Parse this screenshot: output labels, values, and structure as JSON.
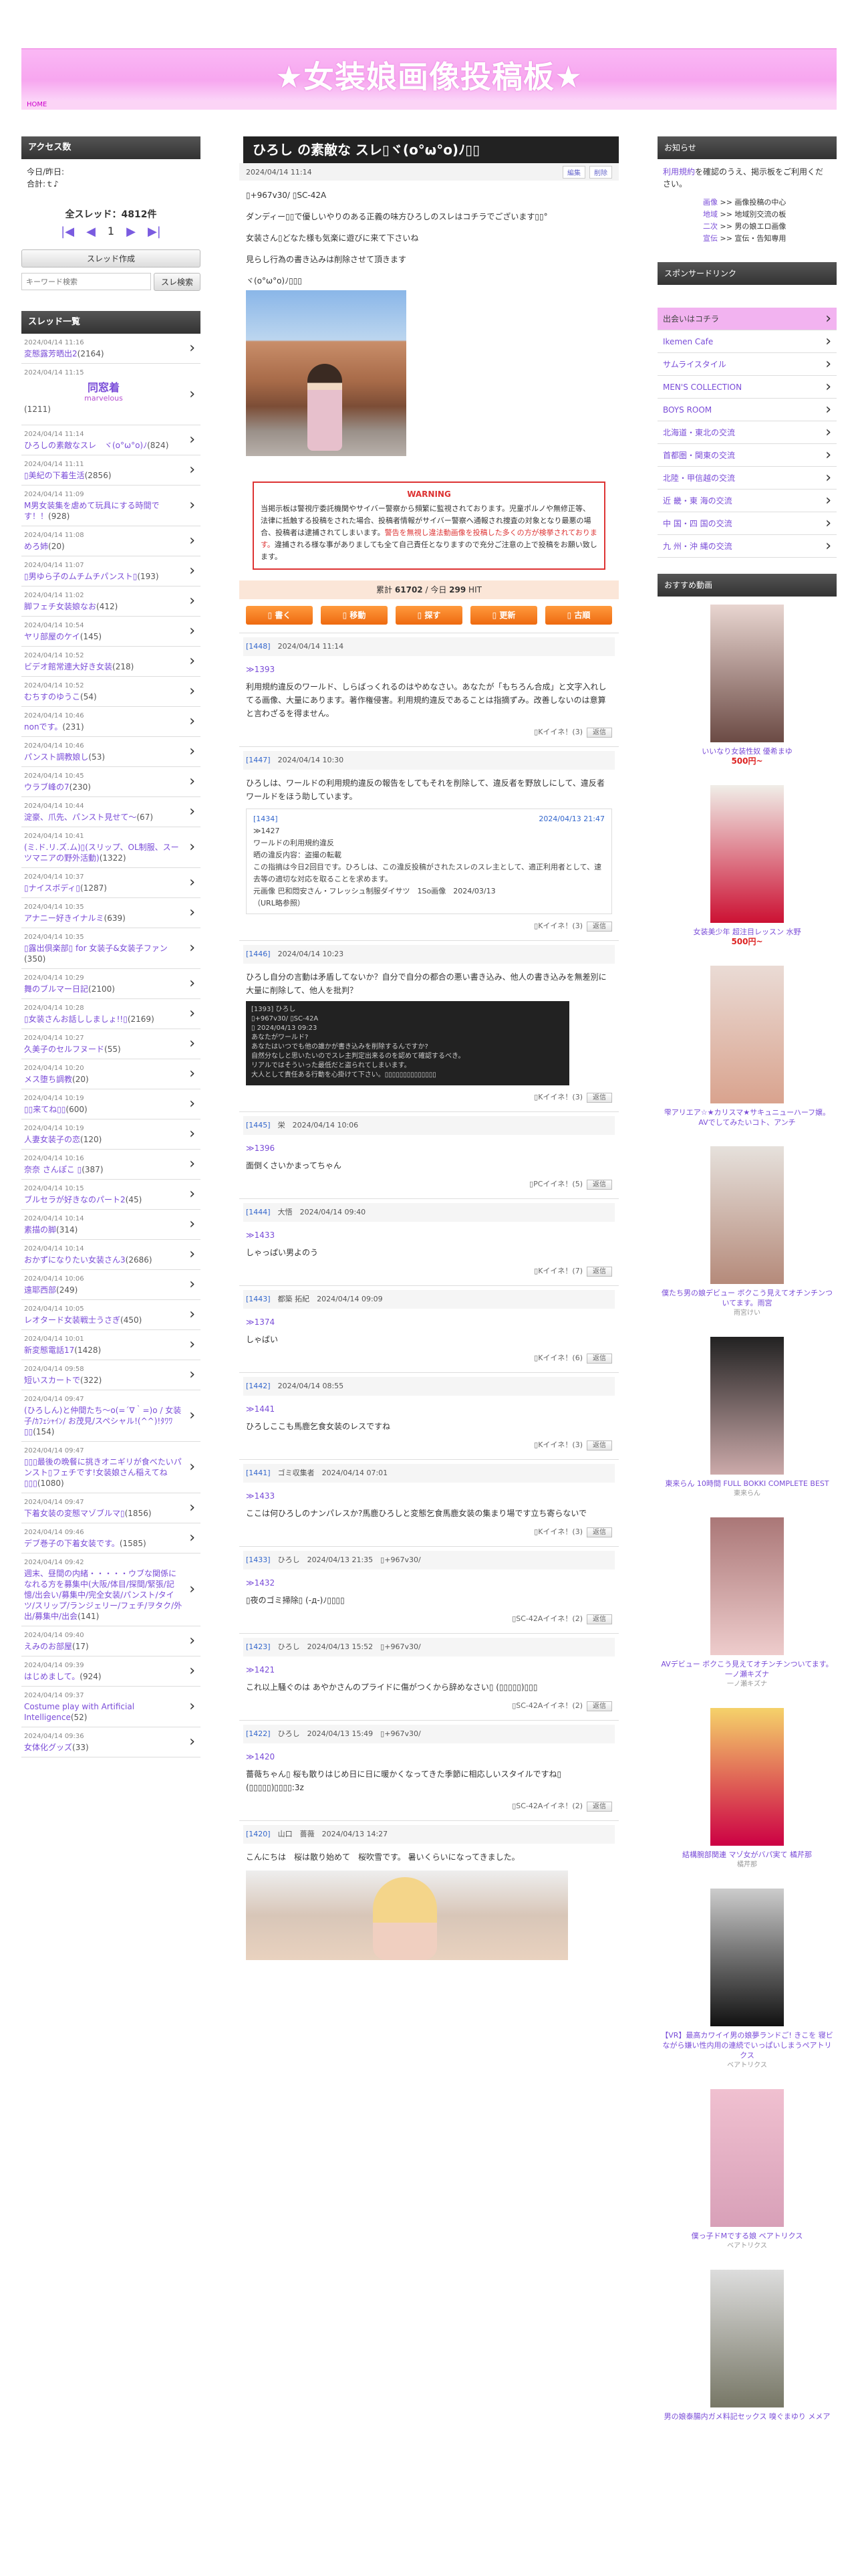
{
  "site": {
    "title": "★女装娘画像投稿板★",
    "crumb": "HOME"
  },
  "left": {
    "access_title": "アクセス数",
    "today": "今日/昨日:",
    "total": "合計:ｔ♪",
    "thread_count": "全スレッド：4812件",
    "page": "1",
    "create_btn": "スレッド作成",
    "search_placeholder": "キーワード検索",
    "search_btn": "スレ検索",
    "list_title": "スレッド一覧",
    "threads": [
      {
        "d": "2024/04/14 11:16",
        "t": "変態露芳晒出2",
        "c": "(2164)"
      },
      {
        "d": "2024/04/14 11:15",
        "t": "同窓着",
        "s": "marvelous",
        "c": "(1211)",
        "big": true
      },
      {
        "d": "2024/04/14 11:14",
        "t": "ひろしの素敵なスレ　ヾ(o°ω°o)ﾉ",
        "c": "(824)"
      },
      {
        "d": "2024/04/14 11:11",
        "t": "▯美紀の下着生活",
        "c": "(2856)"
      },
      {
        "d": "2024/04/14 11:09",
        "t": "M男女装集を虐めて玩具にする時間です！！",
        "c": "(928)"
      },
      {
        "d": "2024/04/14 11:08",
        "t": "めろ姉",
        "c": "(20)"
      },
      {
        "d": "2024/04/14 11:07",
        "t": "▯男ゆら子のムチムチパンスト▯",
        "c": "(193)"
      },
      {
        "d": "2024/04/14 11:02",
        "t": "脚フェチ女装娘なお",
        "c": "(412)"
      },
      {
        "d": "2024/04/14 10:54",
        "t": "ヤリ部屋のケイ",
        "c": "(145)"
      },
      {
        "d": "2024/04/14 10:52",
        "t": "ビデオ館常連大好き女装",
        "c": "(218)"
      },
      {
        "d": "2024/04/14 10:52",
        "t": "むちすのゆうこ",
        "c": "(54)"
      },
      {
        "d": "2024/04/14 10:46",
        "t": "nonです。",
        "c": "(231)"
      },
      {
        "d": "2024/04/14 10:46",
        "t": "パンスト調教娘し",
        "c": "(53)"
      },
      {
        "d": "2024/04/14 10:45",
        "t": "ウラブ峰の7",
        "c": "(230)"
      },
      {
        "d": "2024/04/14 10:44",
        "t": "淀豪、爪先、パンスト見せて〜",
        "c": "(67)"
      },
      {
        "d": "2024/04/14 10:41",
        "t": "(ミ.ド.リ.ズ.ム)▯(スリップ、OL制服、スーツマニアの野外活動)",
        "c": "(1322)"
      },
      {
        "d": "2024/04/14 10:37",
        "t": "▯ナイスボディ▯",
        "c": "(1287)"
      },
      {
        "d": "2024/04/14 10:35",
        "t": "アナニー好きイナルミ",
        "c": "(639)"
      },
      {
        "d": "2024/04/14 10:35",
        "t": "▯露出倶楽部▯ for 女装子&女装子ファン",
        "c": "(350)"
      },
      {
        "d": "2024/04/14 10:29",
        "t": "舞のブルマー日記",
        "c": "(2100)"
      },
      {
        "d": "2024/04/14 10:28",
        "t": "▯女装さんお話ししましょ!!▯",
        "c": "(2169)"
      },
      {
        "d": "2024/04/14 10:27",
        "t": "久美子のセルフヌード",
        "c": "(55)"
      },
      {
        "d": "2024/04/14 10:20",
        "t": "メス堕ち調教",
        "c": "(20)"
      },
      {
        "d": "2024/04/14 10:19",
        "t": "▯▯来てね▯▯",
        "c": "(600)"
      },
      {
        "d": "2024/04/14 10:19",
        "t": "人妻女装子の恋",
        "c": "(120)"
      },
      {
        "d": "2024/04/14 10:16",
        "t": "奈奈 さんぽこ ▯",
        "c": "(387)"
      },
      {
        "d": "2024/04/14 10:15",
        "t": "ブルセラが好きなのパート2",
        "c": "(45)"
      },
      {
        "d": "2024/04/14 10:14",
        "t": "素描の脚",
        "c": "(314)"
      },
      {
        "d": "2024/04/14 10:14",
        "t": "おかずになりたい女装さん3",
        "c": "(2686)"
      },
      {
        "d": "2024/04/14 10:06",
        "t": "遠耶西部",
        "c": "(249)"
      },
      {
        "d": "2024/04/14 10:05",
        "t": "レオタード女装戦士うさぎ",
        "c": "(450)"
      },
      {
        "d": "2024/04/14 10:01",
        "t": "新変態電話17",
        "c": "(1428)"
      },
      {
        "d": "2024/04/14 09:58",
        "t": "短いスカートで",
        "c": "(322)"
      },
      {
        "d": "2024/04/14 09:47",
        "t": "(ひろしん)と仲間たち〜o(=´∇｀=)o / 女装子/ｶﾌｪｼｬｲﾝ/ お茂見/スペシャル!(^^)!ﾀﾜﾜ▯▯",
        "c": "(154)"
      },
      {
        "d": "2024/04/14 09:47",
        "t": "▯▯▯最後の晩餐に挑きオニギリが食べたいパンスト▯フェチです!女装娘さん稲えてね▯▯▯",
        "c": "(1080)"
      },
      {
        "d": "2024/04/14 09:47",
        "t": "下着女装の変態マゾブルマ▯",
        "c": "(1856)"
      },
      {
        "d": "2024/04/14 09:46",
        "t": "デブ巻子の下着女装です。",
        "c": "(1585)"
      },
      {
        "d": "2024/04/14 09:42",
        "t": "週末、昼間の内緒・・・・・ウブな関係になれる方を募集中(大阪/体目/探間/緊張/記憶/出会い/募集中/完全女装/パンスト/タイツ/スリップ/ランジェリー/フェチ/ヲタク/外出/募集中/出会",
        "c": "(141)"
      },
      {
        "d": "2024/04/14 09:40",
        "t": "えみのお部屋",
        "c": "(17)"
      },
      {
        "d": "2024/04/14 09:39",
        "t": "はじめまして。",
        "c": "(924)"
      },
      {
        "d": "2024/04/14 09:37",
        "t": "Costume play with Artificial Intelligence",
        "c": "(52)"
      },
      {
        "d": "2024/04/14 09:36",
        "t": "女体化グッズ",
        "c": "(33)"
      }
    ]
  },
  "main": {
    "title": "ひろし の素敵な スレ▯ヾ(o°ω°o)ﾉ▯▯",
    "date": "2024/04/14 11:14",
    "edit": "編集",
    "delete": "削除",
    "op_id": "▯+967v30/ ▯SC-42A",
    "op_lines": [
      "ダンディー▯▯で優しいやりのある正義の味方ひろしのスレはコチラでございます▯▯°",
      "女装さん▯どなた様も気楽に遊びに来て下さいね",
      "見らし行為の書き込みは削除させて頂きます",
      "ヾ(o°ω°o)ﾉ▯▯▯"
    ],
    "warn_title": "WARNING",
    "warn_text": "当掲示板は警視庁委託機関やサイバー警察から頻繁に監視されております。児童ポルノや無修正等、法律に抵触する投稿をされた場合、投稿者情報がサイバー警察へ通報され捜査の対象となり最悪の場合、投稿者は逮捕されてしまいます。",
    "warn_red": "警告を無視し違法動画像を投稿した多くの方が検挙されております。",
    "warn_tail": "違捕される様な事がありましても全て自己責任となりますので充分ご注意の上で投稿をお願い致します。",
    "stat_a": "累計",
    "stat_total": "61702",
    "stat_b": "/ 今日",
    "stat_today": "299",
    "stat_c": "HIT",
    "actions": [
      "▯ 書く",
      "▯ 移動",
      "▯ 探す",
      "▯ 更新",
      "▯ 古順"
    ],
    "posts": [
      {
        "n": "[1448]",
        "name": "",
        "date": "2024/04/14 11:14",
        "ref": "≫1393",
        "body": "利用規約違反のワールド、しらばっくれるのはやめなさい。あなたが「もちろん合成」と文字入れしてる画像、大量にあります。著作権侵害。利用規約違反であることは指摘ずみ。改善しないのは意算と言わざるを得ません。",
        "foot": "▯Kイイネ！(3)",
        "reply": "返信"
      },
      {
        "n": "[1447]",
        "name": "",
        "date": "2024/04/14 10:30",
        "ref": "",
        "body": "ひろしは、ワールドの利用規約違反の報告をしてもそれを削除して、違反者を野放しにして、違反者ワールドをほう助しています。",
        "q": {
          "n": "[1434]",
          "date": "2024/04/13 21:47",
          "ref": "≫1427",
          "l1": "ワールドの利用規約違反",
          "l2": "晒の違反内容：盗撮の転載",
          "l3": "この指摘は今日2回目です。ひろしは、この違反投稿がされたスレのスレ主として、適正利用者として、速去等の適切な対応を取ることを求めます。",
          "l4": "元画像 巴和悶安さん・フレッシュ制服ダイサツ　1So画像　2024/03/13",
          "l5": "（URL略参照）"
        },
        "foot": "▯Kイイネ！(3)",
        "reply": "返信"
      },
      {
        "n": "[1446]",
        "name": "",
        "date": "2024/04/14 10:23",
        "ref": "",
        "body": "ひろし自分の言動は矛盾してないか？自分で自分の都合の悪い書き込み、他人の書き込みを無差別に大量に削除して、他人を批判？",
        "dark": [
          "[1393] ひろし",
          "▯+967v30/ ▯SC-42A",
          "▯ 2024/04/13 09:23",
          "あなたがワールド?",
          "あなたはいつでも他の誰かが書き込みを削除するんですか?",
          "自然分なしと思いたいのでスレ主判定出来るのを認めて確認するべき。",
          "リアルではそういった最低だと盗られてしまいます。",
          "大人として責任ある行動を心掛けて下さい。▯▯▯▯▯▯▯▯▯▯▯▯▯▯"
        ],
        "foot": "▯Kイイネ！(3)",
        "reply": "返信"
      },
      {
        "n": "[1445]",
        "name": "栄",
        "date": "2024/04/14 10:06",
        "ref": "≫1396",
        "body": "面倒くさいかまってちゃん",
        "foot": "▯PCイイネ！(5)",
        "reply": "返信"
      },
      {
        "n": "[1444]",
        "name": "大悟",
        "date": "2024/04/14 09:40",
        "ref": "≫1433",
        "body": "しゃっぱい男よのう",
        "foot": "▯Kイイネ！(7)",
        "reply": "返信"
      },
      {
        "n": "[1443]",
        "name": "都築 拓紀",
        "date": "2024/04/14 09:09",
        "ref": "≫1374",
        "body": "しゃばい",
        "foot": "▯Kイイネ！(6)",
        "reply": "返信"
      },
      {
        "n": "[1442]",
        "name": "",
        "date": "2024/04/14 08:55",
        "ref": "≫1441",
        "body": "ひろしここも馬鹿乞食女装のレスですね",
        "foot": "▯Kイイネ！(3)",
        "reply": "返信"
      },
      {
        "n": "[1441]",
        "name": "ゴミ収集者",
        "date": "2024/04/14 07:01",
        "ref": "≫1433",
        "body": "ここは何ひろしのナンパレスか?馬鹿ひろしと変態乞食馬鹿女装の集まり場です立ち寄らないで",
        "foot": "▯Kイイネ！(3)",
        "reply": "返信"
      },
      {
        "n": "[1433]",
        "name": "ひろし",
        "date": "2024/04/13 21:35　▯+967v30/",
        "ref": "≫1432",
        "body": "▯夜のゴミ掃除▯ (-д-)ﾉ▯▯▯▯",
        "foot": "▯SC-42Aイイネ！(2)",
        "reply": "返信"
      },
      {
        "n": "[1423]",
        "name": "ひろし",
        "date": "2024/04/13 15:52　▯+967v30/",
        "ref": "≫1421",
        "body": "これ以上騒ぐのは あやかさんのプライドに傷がつくから辞めなさい▯ (▯▯▯▯▯)▯▯▯",
        "foot": "▯SC-42Aイイネ！(2)",
        "reply": "返信"
      },
      {
        "n": "[1422]",
        "name": "ひろし",
        "date": "2024/04/13 15:49　▯+967v30/",
        "ref": "≫1420",
        "body": "薔薇ちゃん▯ 桜も散りはじめ日に日に暖かくなってきた季節に相応しいスタイルですね▯ (▯▯▯▯▯)▯▯▯▯:3z",
        "foot": "▯SC-42Aイイネ！(2)",
        "reply": "返信"
      },
      {
        "n": "[1420]",
        "name": "山口　薔薇",
        "date": "2024/04/13 14:27",
        "ref": "",
        "body": "こんにちは　桜は散り始めて　桜吹雪です。 暑いくらいになってきました。",
        "foot": "",
        "reply": ""
      }
    ]
  },
  "right": {
    "notice_title": "お知らせ",
    "notice_link": "利用規約",
    "notice_text": "を確認のうえ、掲示板をご利用ください。",
    "cats": [
      {
        "k": "画像",
        "v": ">> 画像投稿の中心"
      },
      {
        "k": "地域",
        "v": ">> 地域別交流の板"
      },
      {
        "k": "二次",
        "v": ">> 男の娘エロ画像"
      },
      {
        "k": "宣伝",
        "v": ">> 宣伝・告知専用"
      }
    ],
    "sponsor_title": "スポンサードリンク",
    "meet_head": "出会いはコチラ",
    "meets": [
      "Ikemen Cafe",
      "サムライスタイル",
      "MEN'S COLLECTION",
      "BOYS ROOM",
      "北海道・東北の交流",
      "首都圏・関東の交流",
      "北陸・甲信越の交流",
      "近 畿・東 海の交流",
      "中 国・四 国の交流",
      "九 州・沖 縄の交流"
    ],
    "video_title": "おすすめ動画",
    "videos": [
      {
        "name": "いいなり女装性奴 優希まゆ",
        "price": "500円~",
        "sub": ""
      },
      {
        "name": "女装美少年 超注目レッスン 水野",
        "price": "500円~",
        "sub": ""
      },
      {
        "name": "雫アリエア☆★カリスマ★サキュニューハーフ嬢。AVでしてみたいコト、アンチ",
        "price": "",
        "sub": ""
      },
      {
        "name": "僕たち男の娘デビュー ボクこう見えてオチンチンついてます。雨宮",
        "price": "",
        "sub": "雨宮けい"
      },
      {
        "name": "東来らん 10時間 FULL BOKKI COMPLETE BEST",
        "price": "",
        "sub": "東来らん"
      },
      {
        "name": "AVデビュー ボクこう見えてオチンチンついてます。一ノ瀬キズナ",
        "price": "",
        "sub": "一ノ瀬キズナ"
      },
      {
        "name": "結構腕部関連 マゾ女がバパ実て 橘芹那",
        "price": "",
        "sub": "橘芹那"
      },
      {
        "name": "【VR】最高カワイイ男の娘夢ランドご! きこを 寝ビながら嫌い性内用の連続でいっぱいしまうペアトリクス",
        "price": "",
        "sub": "ベアトリクス"
      },
      {
        "name": "僕っ子ドMでする娘 ベアトリクス",
        "price": "",
        "sub": "ベアトリクス"
      },
      {
        "name": "男の娘泰腸内ガメ料記セックス 嗅ぐまゆり メメア",
        "price": "",
        "sub": ""
      }
    ]
  },
  "colors": {
    "accent": "#f7a6ef",
    "link": "#7a4cd8",
    "warn": "#d33",
    "action": "#ee6a10"
  }
}
